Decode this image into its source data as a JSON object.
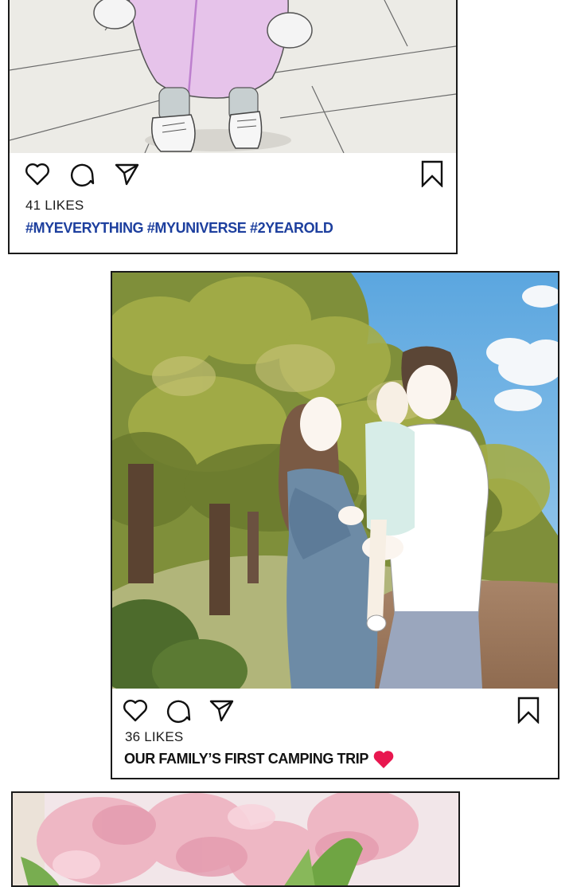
{
  "posts": [
    {
      "likes": "41 LIKES",
      "caption": "#MYEVERYTHING #MYUNIVERSE #2YEAROLD"
    },
    {
      "likes": "36 LIKES",
      "caption": "OUR FAMILY’S FIRST CAMPING TRIP"
    },
    {}
  ],
  "colors": {
    "hashtag": "#1d3f9e",
    "heart": "#e8174f",
    "border": "#1a1a1a"
  },
  "icons": [
    "heart-outline-icon",
    "comment-icon",
    "send-icon",
    "bookmark-icon",
    "red-heart-icon"
  ]
}
